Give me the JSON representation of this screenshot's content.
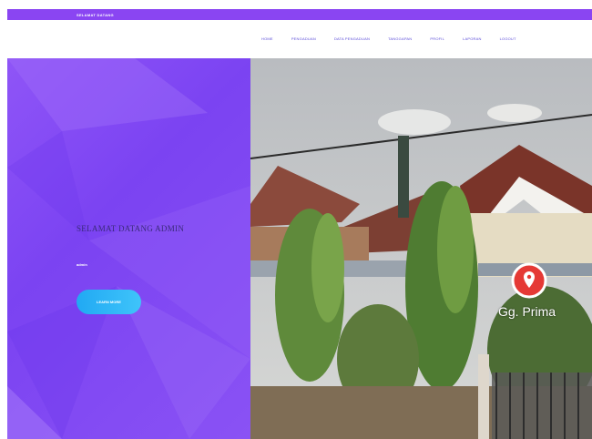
{
  "topbar": {
    "text": "SELAMAT DATANG"
  },
  "nav": {
    "items": [
      "Home",
      "Pengaduan",
      "Data Pengaduan",
      "Tanggapan",
      "Profil",
      "Laporan",
      "Logout"
    ]
  },
  "hero": {
    "title": "SELAMAT DATANG ADMIN",
    "subtitle": "admin",
    "button_label": "Learn More"
  },
  "photo": {
    "place_label": "Gg. Prima"
  },
  "colors": {
    "accent": "#8a45f2",
    "button": "#2bb3f6",
    "nav_text": "#5a4bd8"
  }
}
